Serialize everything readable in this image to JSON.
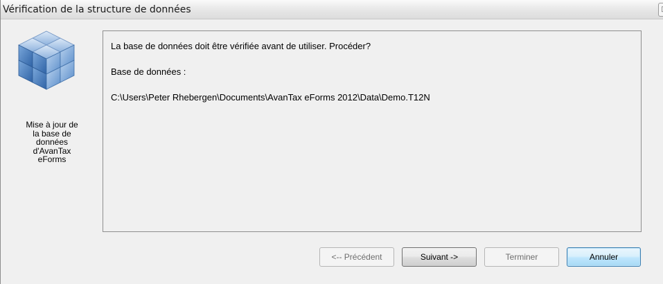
{
  "window": {
    "title": "Vérification de la structure de données",
    "control_glyph": "▯"
  },
  "sidebar": {
    "icon": "database-cube-icon",
    "caption": "Mise à jour de\nla base de\ndonnées\nd'AvanTax\neForms"
  },
  "content": {
    "prompt": "La base de données doit être vérifiée avant de utiliser. Procéder?",
    "db_label": "Base de données :",
    "db_path": "C:\\Users\\Peter Rhebergen\\Documents\\AvanTax eForms 2012\\Data\\Demo.T12N"
  },
  "buttons": {
    "previous": "<-- Précédent",
    "next": "Suivant ->",
    "finish": "Terminer",
    "cancel": "Annuler"
  },
  "colors": {
    "window_bg": "#f0f0f0",
    "cube_blue": "#4a7fbf",
    "default_button_border": "#3c7fb1"
  }
}
